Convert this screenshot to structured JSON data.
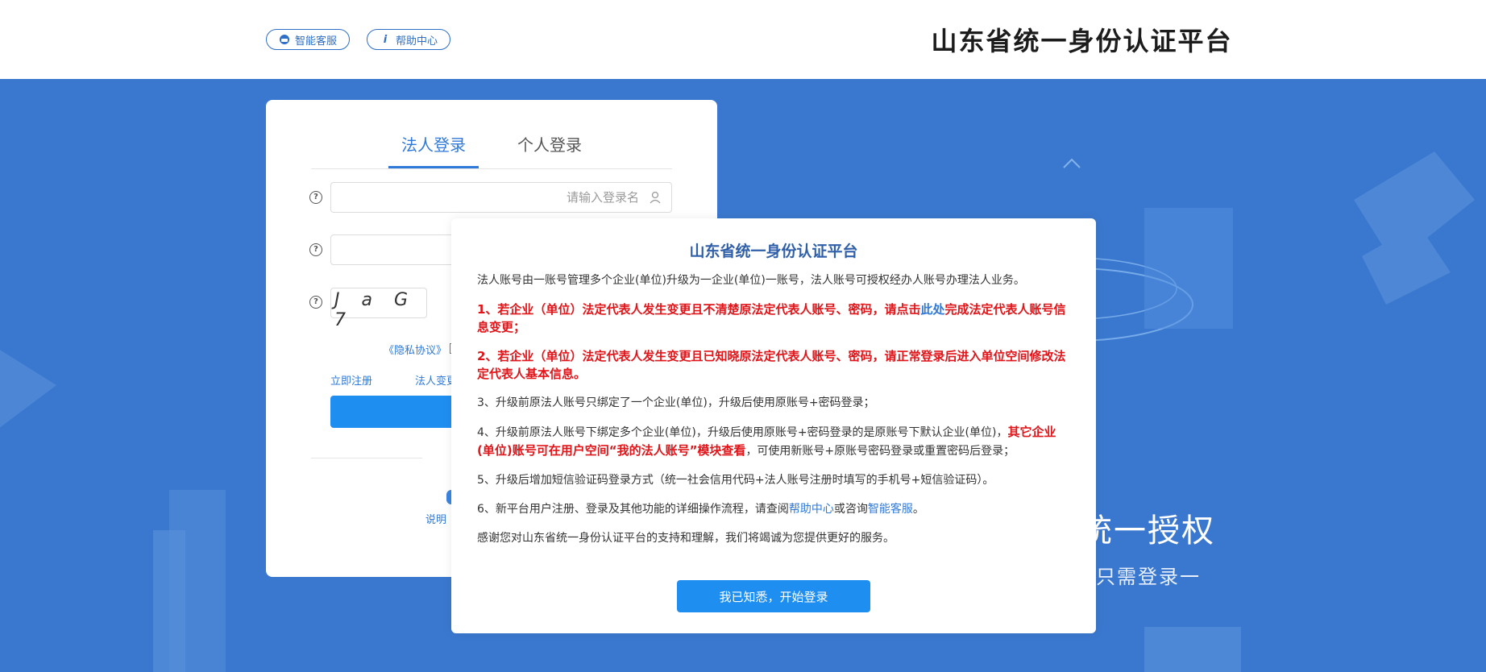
{
  "header": {
    "site_title": "山东省统一身份认证平台",
    "help_center_label": "帮助中心",
    "smart_service_label": "智能客服"
  },
  "hero": {
    "slogan_main": "统一授权",
    "slogan_sub": "只需登录一"
  },
  "login": {
    "tabs": [
      {
        "label": "个人登录",
        "active": false
      },
      {
        "label": "法人登录",
        "active": true
      }
    ],
    "username_placeholder": "请输入登录名",
    "password_value": "",
    "captcha_text": "J a G 7",
    "privacy_text": "《隐私协议》",
    "links": {
      "register": "立即注册",
      "change": "法人变更"
    },
    "bottom_link": "说明"
  },
  "notice": {
    "title": "山东省统一身份认证平台",
    "intro": "法人账号由一账号管理多个企业(单位)升级为一企业(单位)一账号，法人账号可授权经办人账号办理法人业务。",
    "item1": "1、若企业（单位）法定代表人发生变更且不清楚原法定代表人账号、密码，请点击此处完成法定代表人账号信息变更；",
    "item1_prefix": "1、若企业（单位）法定代表人发生变更且不清楚原法定代表人账号、密码，请点击",
    "item1_link": "此处",
    "item1_suffix": "完成法定代表人账号信息变更；",
    "item2": "2、若企业（单位）法定代表人发生变更且已知晓原法定代表人账号、密码，请正常登录后进入单位空间修改法定代表人基本信息。",
    "item3": "3、升级前原法人账号只绑定了一个企业(单位)，升级后使用原账号+密码登录；",
    "item4_normal": "4、升级前原法人账号下绑定多个企业(单位)，升级后使用原账号+密码登录的是原账号下默认企业(单位)，",
    "item4_red": "其它企业(单位)账号可在用户空间“我的法人账号”模块查看",
    "item4_tail": "，可使用新账号+原账号密码登录或重置密码后登录；",
    "item5": "5、升级后增加短信验证码登录方式（统一社会信用代码+法人账号注册时填写的手机号+短信验证码）。",
    "item6_prefix": "6、新平台用户注册、登录及其他功能的详细操作流程，请查阅",
    "item6_link1": "帮助中心",
    "item6_mid": "或咨询",
    "item6_link2": "智能客服",
    "item6_suffix": "。",
    "thanks": "感谢您对山东省统一身份认证平台的支持和理解，我们将竭诚为您提供更好的服务。",
    "confirm_button": "我已知悉，开始登录"
  },
  "colors": {
    "background": "#3a78cf",
    "accent": "#1f8ef1",
    "warning_red": "#e0151a"
  }
}
